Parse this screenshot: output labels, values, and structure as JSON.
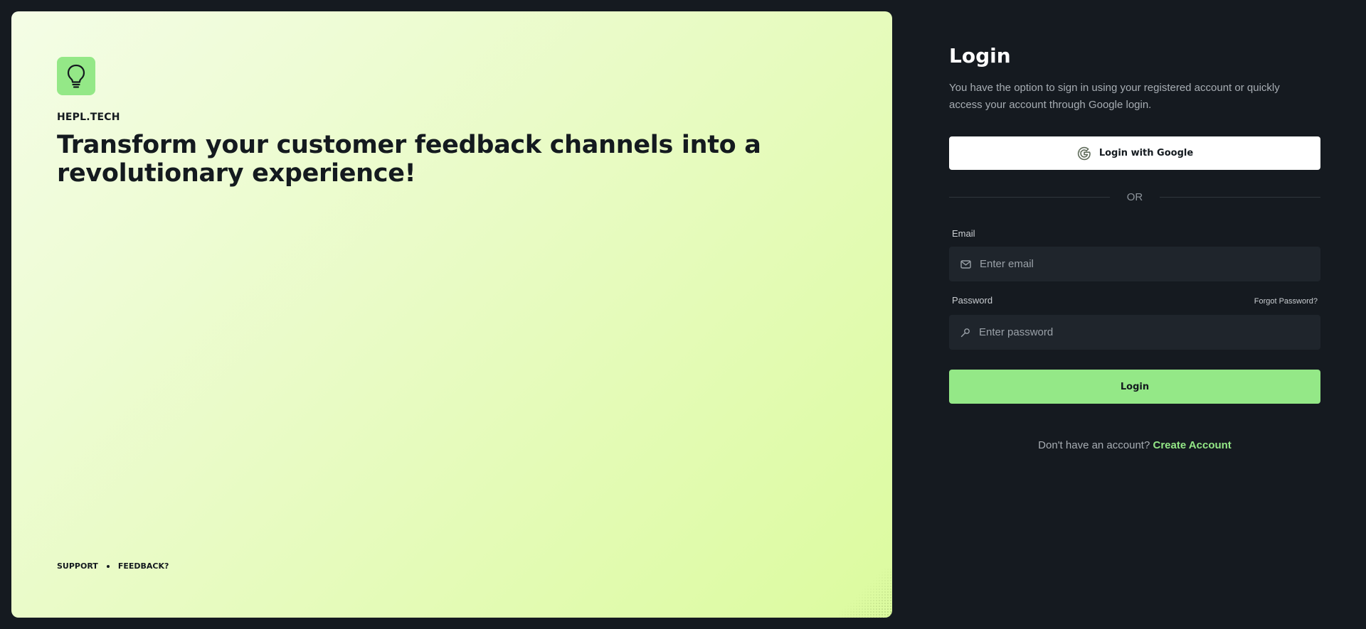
{
  "brand": {
    "name": "HEPL.TECH",
    "headline": "Transform your customer feedback channels into a revolutionary experience!",
    "logo_icon": "lightbulb-icon",
    "accent_color": "#94e887"
  },
  "footer": {
    "links": [
      "SUPPORT",
      "FEEDBACK?"
    ]
  },
  "login": {
    "title": "Login",
    "description": "You have the option to sign in using your registered account or quickly access your account through Google login.",
    "google_button": "Login with Google",
    "divider": "OR",
    "email": {
      "label": "Email",
      "placeholder": "Enter email",
      "icon": "mail-icon"
    },
    "password": {
      "label": "Password",
      "placeholder": "Enter password",
      "icon": "key-icon",
      "forgot": "Forgot Password?"
    },
    "submit": "Login",
    "signup_prompt": "Don't have an account?",
    "signup_link": "Create Account"
  }
}
